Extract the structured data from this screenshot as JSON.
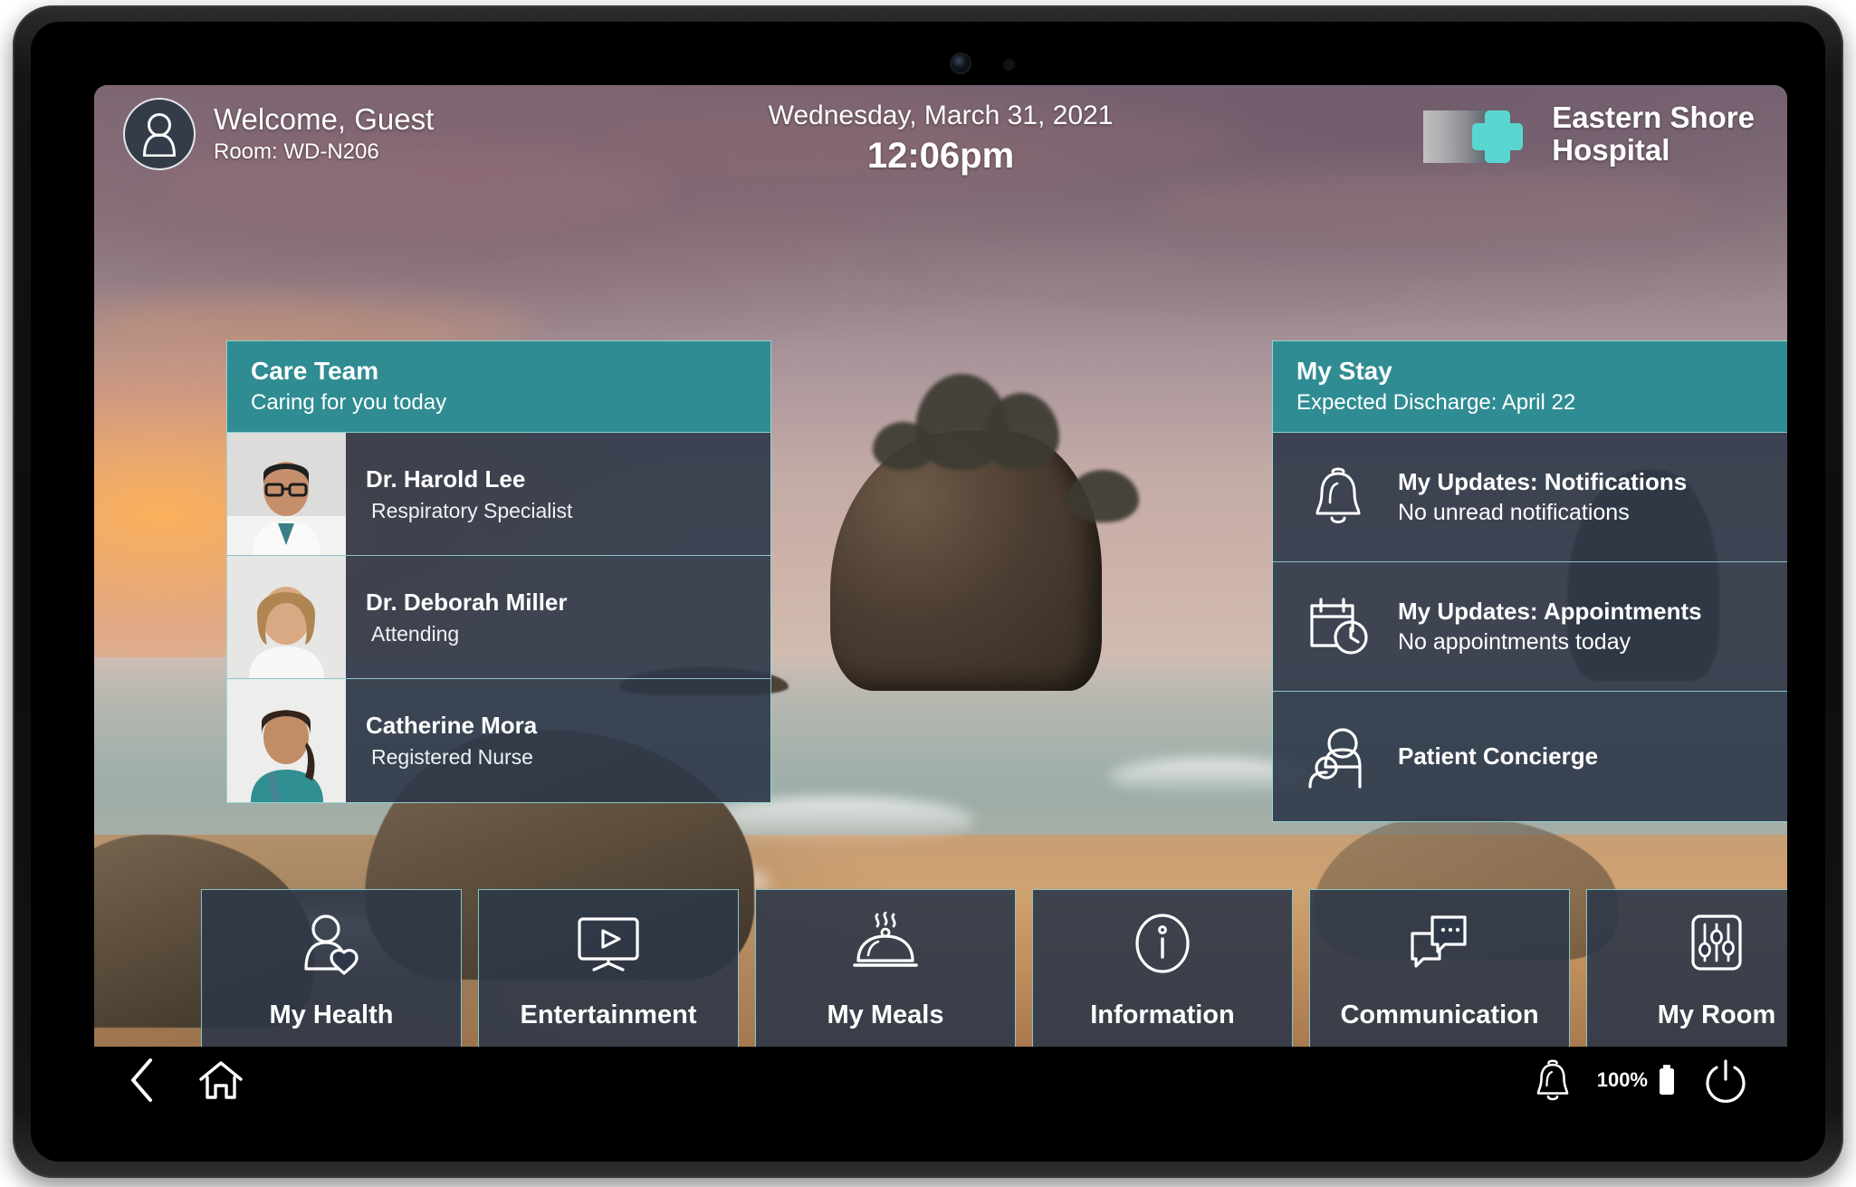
{
  "header": {
    "avatar_icon": "person-icon",
    "welcome_text": "Welcome, Guest",
    "room_text": "Room: WD-N206",
    "date": "Wednesday, March 31, 2021",
    "time": "12:06pm",
    "brand_name_line1": "Eastern Shore",
    "brand_name_line2": "Hospital",
    "brand_icon": "medical-cross-icon"
  },
  "care_team": {
    "title": "Care Team",
    "subtitle": "Caring for you today",
    "members": [
      {
        "name": "Dr. Harold Lee",
        "role": "Respiratory Specialist"
      },
      {
        "name": "Dr. Deborah Miller",
        "role": "Attending"
      },
      {
        "name": "Catherine Mora",
        "role": "Registered Nurse"
      }
    ]
  },
  "my_stay": {
    "title": "My Stay",
    "subtitle": "Expected Discharge: April 22",
    "rows": [
      {
        "icon": "bell-icon",
        "title": "My Updates: Notifications",
        "sub": "No unread notifications"
      },
      {
        "icon": "calendar-clock-icon",
        "title": "My Updates: Appointments",
        "sub": "No appointments today"
      },
      {
        "icon": "two-people-icon",
        "title": "Patient Concierge",
        "sub": ""
      }
    ]
  },
  "tiles": [
    {
      "icon": "person-heart-icon",
      "label": "My Health"
    },
    {
      "icon": "tv-play-icon",
      "label": "Entertainment"
    },
    {
      "icon": "food-cloche-icon",
      "label": "My Meals"
    },
    {
      "icon": "info-circle-icon",
      "label": "Information"
    },
    {
      "icon": "chat-bubbles-icon",
      "label": "Communication"
    },
    {
      "icon": "sliders-icon",
      "label": "My Room"
    }
  ],
  "navbar": {
    "back_icon": "back-chevron-icon",
    "home_icon": "home-icon",
    "bell_icon": "bell-icon",
    "battery_pct": "100%",
    "battery_icon": "battery-full-icon",
    "power_icon": "power-icon"
  },
  "colors": {
    "teal_header": "#2f8c92",
    "panel_body": "#2d3748",
    "panel_border": "#96dcdc",
    "brand_accent": "#5ad6d0"
  }
}
